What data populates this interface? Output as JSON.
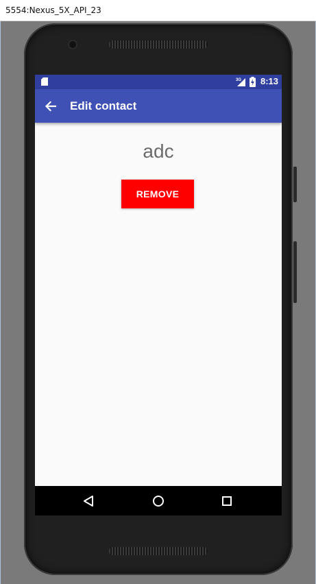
{
  "window": {
    "title": "5554:Nexus_5X_API_23"
  },
  "status_bar": {
    "network": "3G",
    "time": "8:13"
  },
  "app_bar": {
    "title": "Edit contact",
    "back_icon": "arrow-left-icon"
  },
  "content": {
    "contact_name": "adc",
    "remove_label": "REMOVE"
  },
  "nav_bar": {
    "buttons": [
      "back-triangle-icon",
      "home-circle-icon",
      "recents-square-icon"
    ]
  },
  "colors": {
    "status_bar": "#303f9f",
    "app_bar": "#3f51b5",
    "remove_button": "#ff0000",
    "screen_background": "#fafafa"
  }
}
